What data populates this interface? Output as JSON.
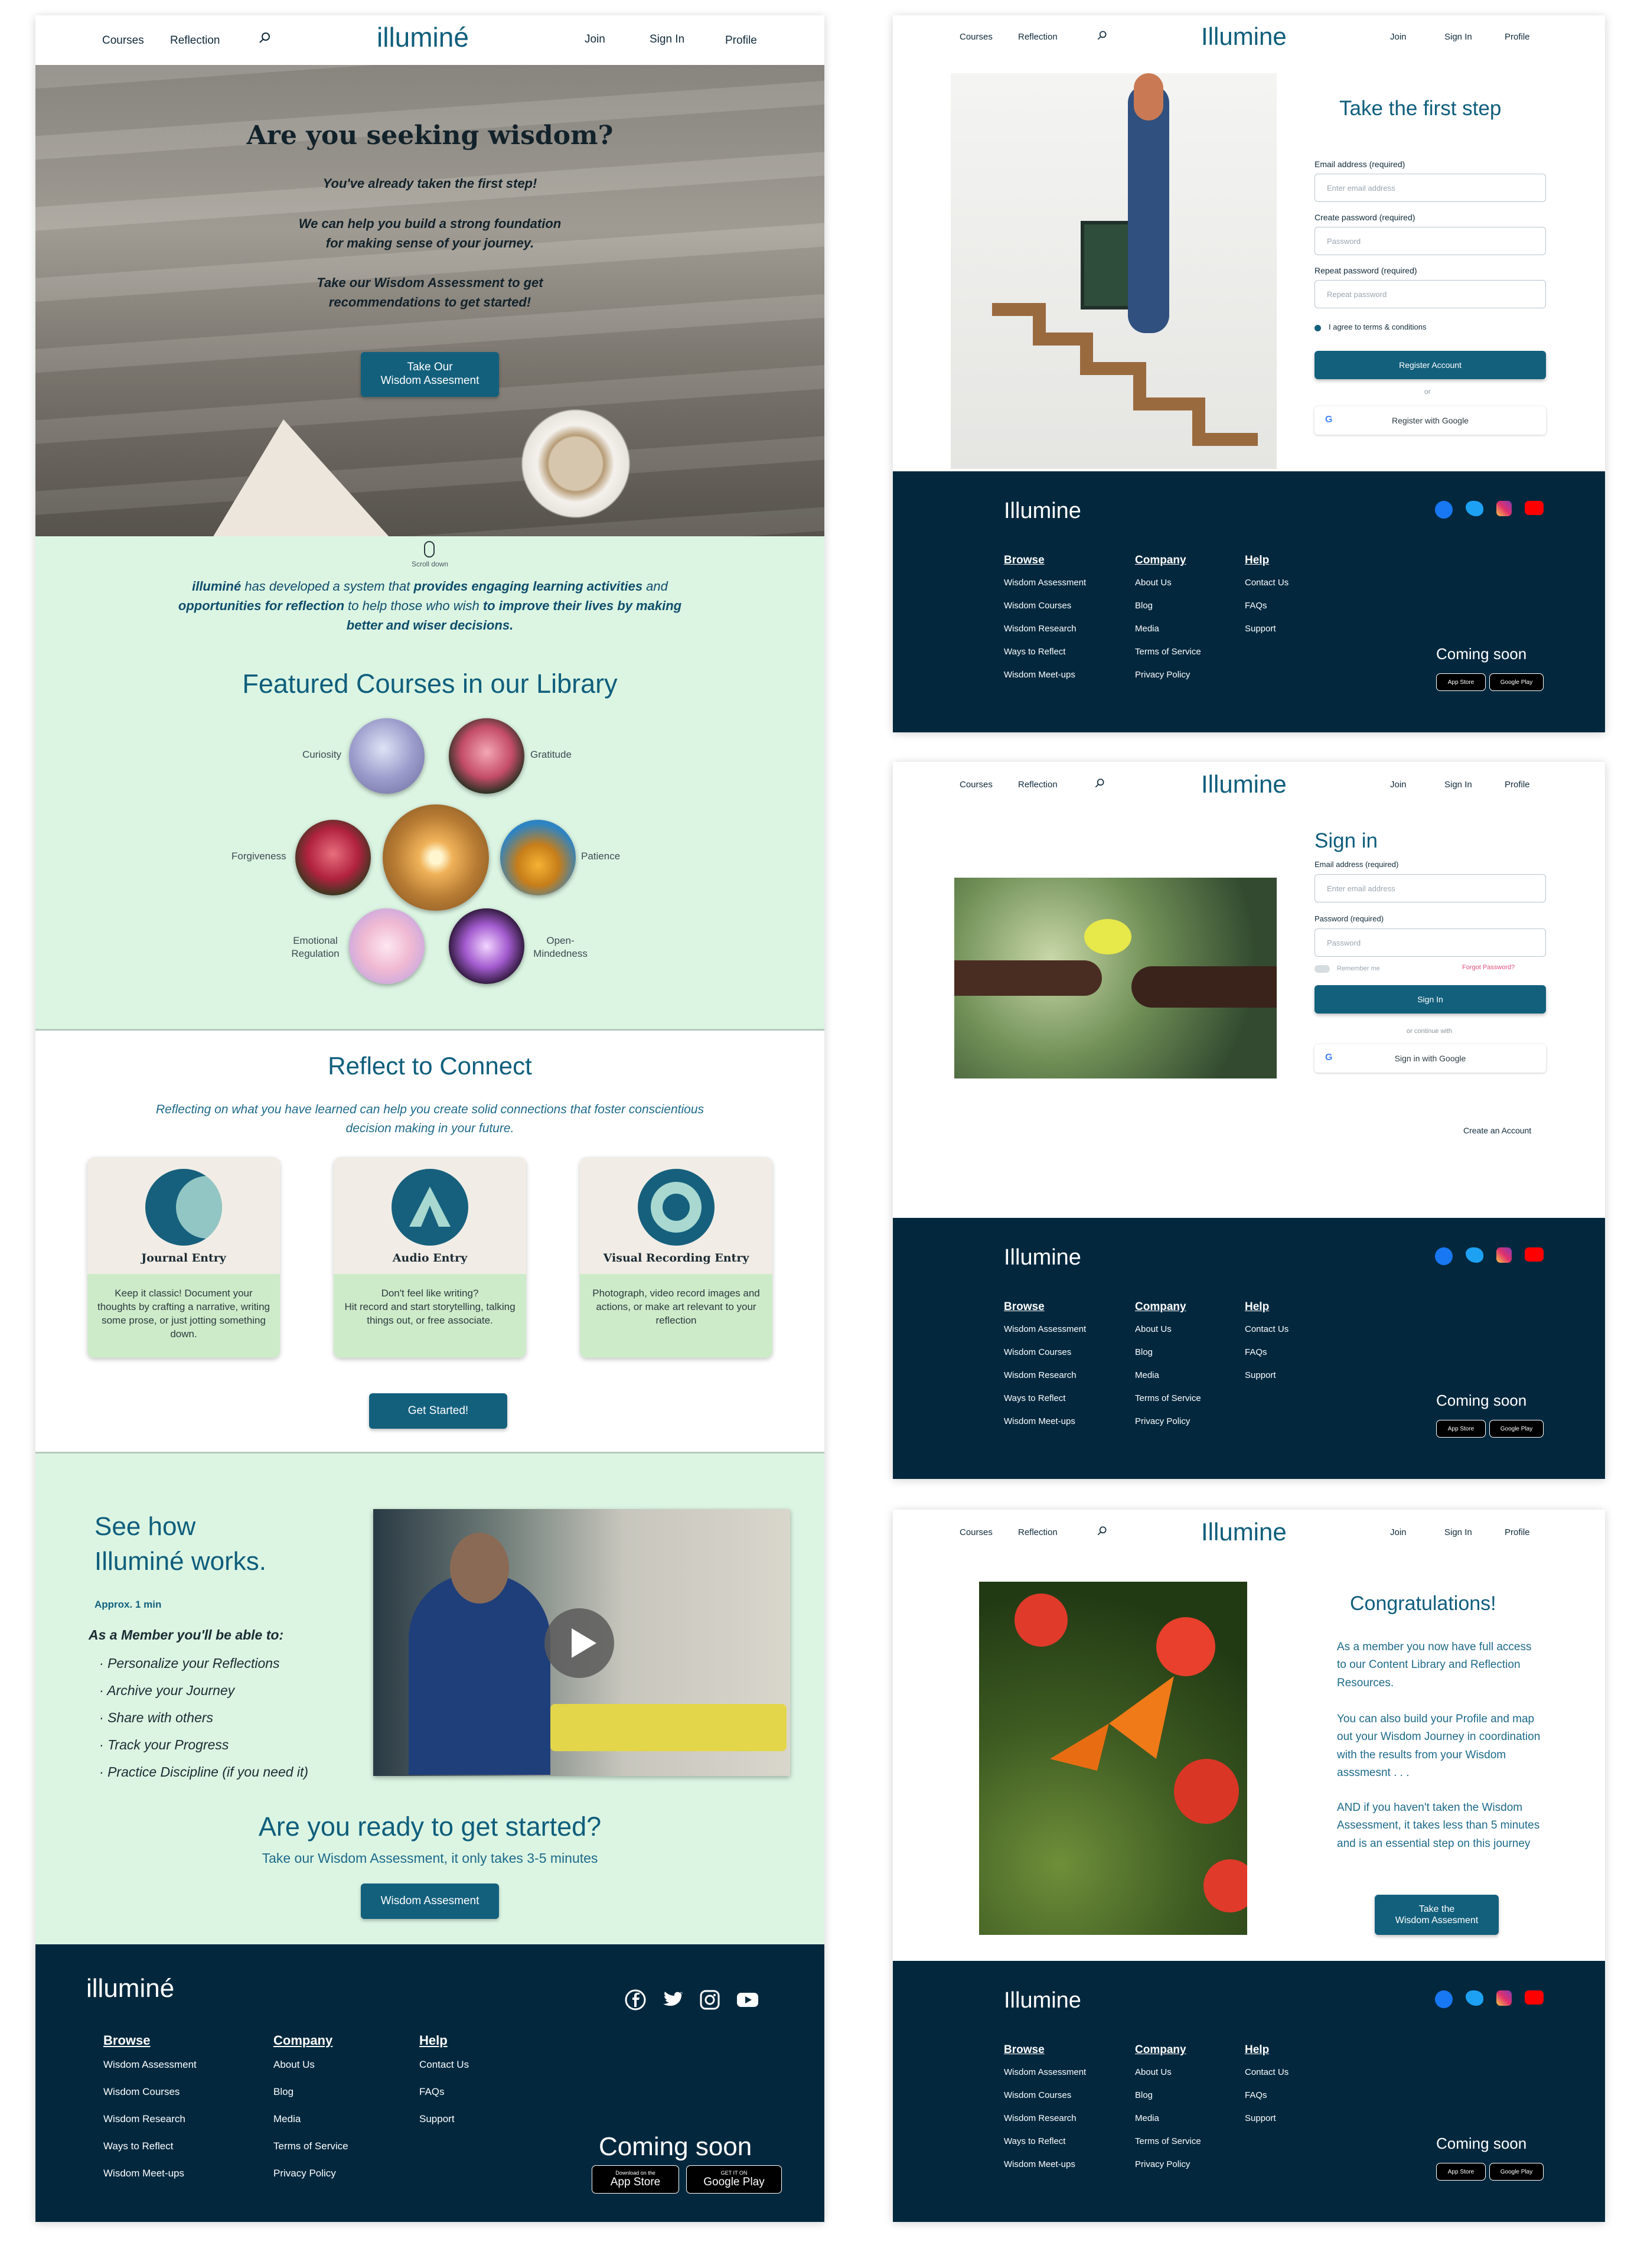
{
  "nav": {
    "courses": "Courses",
    "reflection": "Reflection",
    "join": "Join",
    "signin": "Sign In",
    "profile": "Profile"
  },
  "brand": {
    "main_logo": "illuminé",
    "alt_logo": "Illumine"
  },
  "hero": {
    "title": "Are you seeking wisdom?",
    "line1": "You've already taken the first step!",
    "line2": "We can help you build a strong foundation for making sense of your journey.",
    "line3": "Take our Wisdom Assessment to get recommendations to get started!",
    "button": "Take Our\nWisdom Assesment",
    "scroll": "Scroll down"
  },
  "intro": {
    "p1": "illuminé",
    "p2": " has developed a system that ",
    "p3": "provides engaging learning activities",
    "p4": " and ",
    "p5": "opportunities for reflection",
    "p6": " to help those who wish ",
    "p7": "to improve their lives by making better and wiser decisions."
  },
  "featured": {
    "title": "Featured Courses in our Library",
    "courses": [
      "Curiosity",
      "Gratitude",
      "Forgiveness",
      "Patience",
      "Emotional\nRegulation",
      "Open-\nMindedness"
    ]
  },
  "reflect": {
    "title": "Reflect to Connect",
    "subtitle": "Reflecting on what you have  learned can help you create solid connections that foster conscientious decision making in your future.",
    "cards": [
      {
        "title": "Journal Entry",
        "text": "Keep it classic! Document your thoughts by crafting a narrative, writing some prose, or just jotting something down."
      },
      {
        "title": "Audio Entry",
        "text": "Don't feel like writing?\nHit record and start storytelling, talking things out, or free associate."
      },
      {
        "title": "Visual Recording Entry",
        "text": "Photograph, video record images and actions, or make art relevant to your reflection"
      }
    ],
    "button": "Get Started!"
  },
  "howworks": {
    "title": "See how\nIlluminé works.",
    "duration": "Approx. 1 min",
    "member_heading": "As a Member you'll be able to:",
    "bullets": [
      "Personalize your Reflections",
      "Archive your Journey",
      "Share with others",
      "Track your Progress",
      "Practice Discipline (if you need it)"
    ]
  },
  "ready": {
    "title": "Are you ready to get started?",
    "subtitle": "Take our Wisdom Assessment, it only takes 3-5 minutes",
    "button": "Wisdom Assesment"
  },
  "footer": {
    "browse": "Browse",
    "company": "Company",
    "help": "Help",
    "browse_items": [
      "Wisdom Assessment",
      "Wisdom Courses",
      "Wisdom Research",
      "Ways to Reflect",
      "Wisdom Meet-ups"
    ],
    "company_items": [
      "About Us",
      "Blog",
      "Media",
      "Terms of Service",
      "Privacy Policy"
    ],
    "help_items": [
      "Contact Us",
      "FAQs",
      "Support"
    ],
    "coming_soon": "Coming soon",
    "appstore_small": "Download on the",
    "appstore": "App Store",
    "googleplay_small": "GET IT ON",
    "googleplay": "Google Play"
  },
  "register": {
    "title": "Take the first step",
    "email_label": "Email address (required)",
    "email_ph": "Enter email address",
    "pw_label": "Create password (required)",
    "pw_ph": "Password",
    "rpw_label": "Repeat password (required)",
    "rpw_ph": "Repeat password",
    "terms": "I agree to terms & conditions",
    "button": "Register Account",
    "or": "or",
    "google": "Register with Google"
  },
  "signin": {
    "title": "Sign in",
    "email_label": "Email address (required)",
    "email_ph": "Enter email address",
    "pw_label": "Password (required)",
    "pw_ph": "Password",
    "remember": "Remember me",
    "forgot": "Forgot Password?",
    "button": "Sign In",
    "continue": "or continue with",
    "google": "Sign in with Google",
    "create": "Create an Account"
  },
  "congrats": {
    "title": "Congratulations!",
    "p1": "As a member you now have full access to our Content Library and Reflection Resources.",
    "p2": "You can also build your Profile and map out your Wisdom Journey in coordination with the results from your Wisdom asssmesnt . . .",
    "p3": "AND if you haven't taken the Wisdom Assessment, it takes less than 5 minutes and is an essential step on this journey",
    "button": "Take the\nWisdom Assesment"
  },
  "colors": {
    "accent": "#13607d",
    "mint": "#dcf5e3",
    "footer": "#03283e",
    "title": "#0f5e7c"
  }
}
